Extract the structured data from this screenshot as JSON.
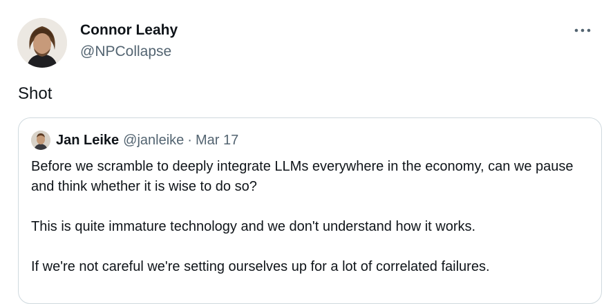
{
  "tweet": {
    "author_name": "Connor Leahy",
    "author_handle": "@NPCollapse",
    "text": "Shot",
    "more_icon": "more-horizontal-icon"
  },
  "quoted": {
    "author_name": "Jan Leike",
    "author_handle": "@janleike",
    "separator": "·",
    "date": "Mar 17",
    "paragraphs": [
      "Before we scramble to deeply integrate LLMs everywhere in the economy, can we pause and think whether it is wise to do so?",
      "This is quite immature technology and we don't understand how it works.",
      "If we're not careful we're setting ourselves up for a lot of correlated failures."
    ]
  },
  "colors": {
    "text_primary": "#0f1419",
    "text_secondary": "#536471",
    "border": "#cfd9de"
  }
}
